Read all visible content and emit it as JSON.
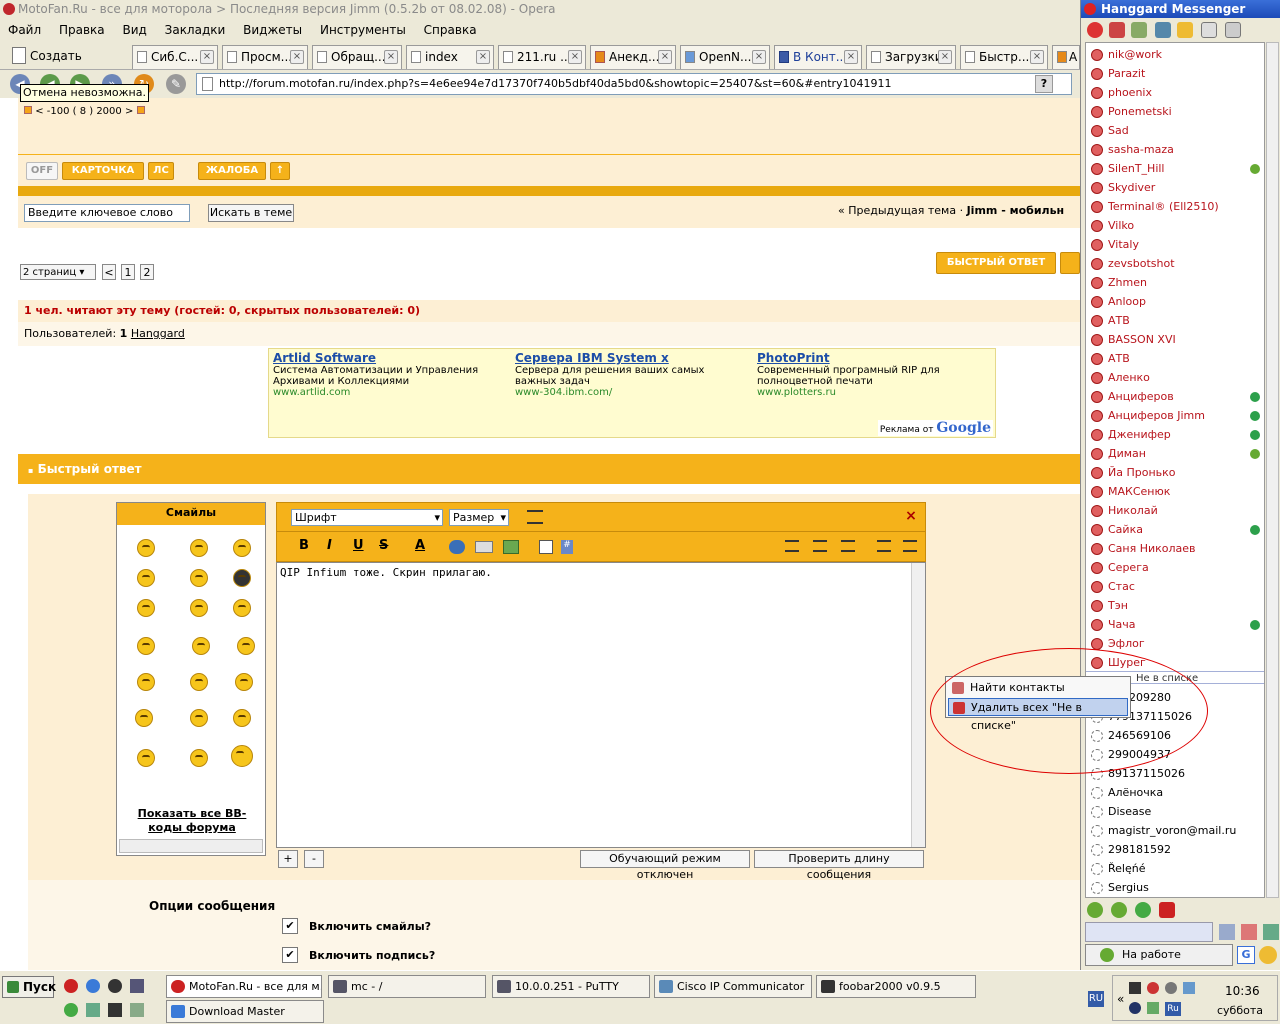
{
  "window_title": "MotoFan.Ru - все для моторола > Последняя версия Jimm (0.5.2b от 08.02.08) - Opera",
  "menu": [
    "Файл",
    "Правка",
    "Вид",
    "Закладки",
    "Виджеты",
    "Инструменты",
    "Справка"
  ],
  "new_tab_label": "Создать вкладку",
  "tabs": [
    "Сиб.С...",
    "Просм...",
    "Обращ...",
    "index",
    "211.ru ...",
    "Анекд...",
    "OpenN...",
    "В Конт...",
    "Загрузки",
    "Быстр...",
    "A"
  ],
  "address_url": "http://forum.motofan.ru/index.php?s=4e6ee94e7d17370f740b5dbf40da5bd0&showtopic=25407&st=60&#entry1041911",
  "tooltip": "Отмена невозможна.",
  "post_rating": "< -100 ( 8 ) 2000 >",
  "post_buttons": {
    "off": "OFF",
    "card": "КАРТОЧКА",
    "pm": "ЛС",
    "complaint": "ЖАЛОБА"
  },
  "search": {
    "input_value": "Введите ключевое слово",
    "button": "Искать в теме"
  },
  "topic_nav": {
    "prev": "« Предыдущая тема",
    "sep": "·",
    "current": "Jimm - мобильн"
  },
  "pagination": {
    "dropdown": "2 страниц",
    "prev": "<",
    "pages": [
      "1",
      "2"
    ]
  },
  "quick_reply_top": "БЫСТРЫЙ ОТВЕТ",
  "readers": {
    "title": "1 чел. читают эту тему (гостей: 0, скрытых пользователей: 0)",
    "users_label": "Пользователей:",
    "users_count": "1",
    "user": "Hanggard"
  },
  "ads": [
    {
      "title": "Artlid Software",
      "desc": "Система Автоматизации и Управления Архивами и Коллекциями",
      "url": "www.artlid.com"
    },
    {
      "title": "Сервера IBM System x",
      "desc": "Сервера для решения ваших самых важных задач",
      "url": "www-304.ibm.com/"
    },
    {
      "title": "PhotoPrint",
      "desc": "Современный програмный RIP для полноцветной печати",
      "url": "www.plotters.ru"
    }
  ],
  "ads_by": "Реклама от",
  "ads_brand": "Google",
  "quick_reply_header": "Быстрый ответ",
  "smileys_title": "Смайлы",
  "show_all_bbcodes": "Показать все BB-коды форума",
  "editor": {
    "font_select": "Шрифт",
    "size_select": "Размер",
    "message_text": "QIP Infium тоже. Скрин прилагаю.",
    "plus": "+",
    "minus": "-",
    "tutorial_btn": "Обучающий режим отключен",
    "check_len_btn": "Проверить длину сообщения"
  },
  "options": {
    "title": "Опции сообщения",
    "enable_smileys": "Включить смайлы?",
    "enable_signature": "Включить подпись?"
  },
  "messenger": {
    "title": "Hanggard Messenger",
    "contacts": [
      "nik@work",
      "Parazit",
      "phoenix",
      "Ponemetski",
      "Sad",
      "sasha-maza",
      "SilenT_Hill",
      "Skydiver",
      "Terminal® (Ell2510)",
      "Vilko",
      "Vitaly",
      "zevsbotshot",
      "Zhmen",
      "Anloop",
      "АТВ",
      "BASSON XVI",
      "АТВ",
      "Аленко",
      "Анциферов",
      "Анциферов Jimm",
      "Дженифер",
      "Диман",
      "Йа Пронько",
      "МАКСенюк",
      "Николай",
      "Сайка",
      "Саня Николаев",
      "Серега",
      "Стас",
      "Тэн",
      "Чача",
      "Эфлог",
      "Шурег"
    ],
    "group_not_in_list": "Не в списке",
    "offline_contacts": [
      "332209280",
      "779137115026",
      "246569106",
      "299004937",
      "89137115026",
      "Алёночка",
      "Disease",
      "magistr_voron@mail.ru",
      "298181592",
      "Řelęńé",
      "Sergius"
    ],
    "status": "На работе"
  },
  "context_menu": [
    "Найти контакты",
    "Удалить всех \"Не в списке\""
  ],
  "taskbar": {
    "start": "Пуск",
    "tasks": [
      "MotoFan.Ru - все для м...",
      "mc - /",
      "10.0.0.251 - PuTTY",
      "Cisco IP Communicator",
      "foobar2000 v0.9.5",
      "Download Master"
    ],
    "lang": "RU",
    "time": "10:36",
    "day": "суббота"
  }
}
